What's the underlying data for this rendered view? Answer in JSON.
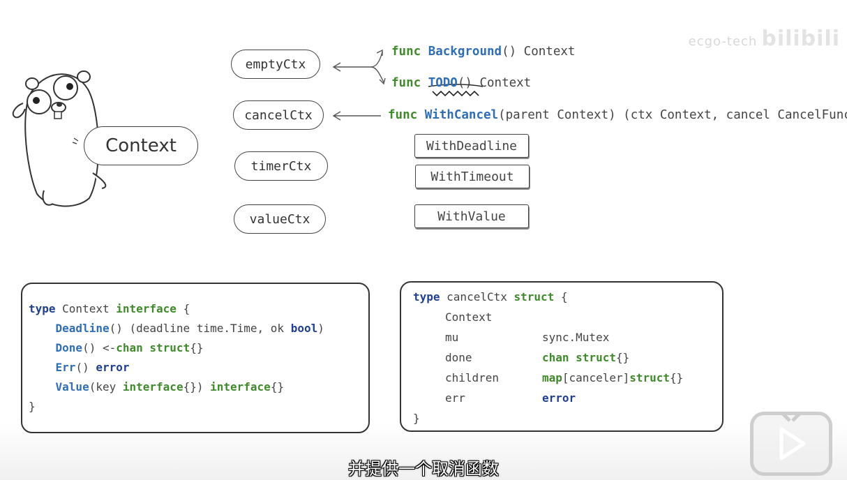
{
  "watermark": {
    "text": "ecgo-tech",
    "logo": "bilibili"
  },
  "ctx_types": [
    "emptyCtx",
    "cancelCtx",
    "timerCtx",
    "valueCtx"
  ],
  "mascot": {
    "label": "Context"
  },
  "signatures": {
    "background": {
      "kw": "func",
      "name": "Background",
      "rest": "() Context"
    },
    "todo": {
      "kw": "func",
      "name": "TODO",
      "rest": "() Context"
    },
    "withcancel": {
      "kw": "func",
      "name": "WithCancel",
      "rest": "(parent Context) (ctx Context, cancel CancelFunc)"
    }
  },
  "with_boxes": [
    "WithDeadline",
    "WithTimeout",
    "WithValue"
  ],
  "code_interface": {
    "l1": {
      "a": "type",
      "b": " Context ",
      "c": "interface",
      "d": " {"
    },
    "l2": {
      "a": "Deadline",
      "b": "() (deadline time.Time, ok ",
      "c": "bool",
      "d": ")"
    },
    "l3": {
      "a": "Done",
      "b": "() <-",
      "c": "chan struct",
      "d": "{}"
    },
    "l4": {
      "a": "Err",
      "b": "() ",
      "c": "error"
    },
    "l5": {
      "a": "Value",
      "b": "(key ",
      "c": "interface",
      "d": "{}) ",
      "e": "interface",
      "f": "{}"
    },
    "l6": "}"
  },
  "code_struct": {
    "l1": {
      "a": "type",
      "b": " cancelCtx ",
      "c": "struct",
      "d": " {"
    },
    "fields": [
      {
        "name": "Context",
        "type_plain": "",
        "type_kw": "",
        "type_rest": ""
      },
      {
        "name": "mu",
        "type_plain": "sync.Mutex",
        "type_kw": "",
        "type_rest": ""
      },
      {
        "name": "done",
        "type_plain": "",
        "type_kw": "chan struct",
        "type_rest": "{}"
      },
      {
        "name": "children",
        "type_plain": "",
        "type_kw": "map",
        "type_rest": "[canceler]",
        "type_kw2": "struct",
        "type_rest2": "{}"
      },
      {
        "name": "err",
        "type_plain": "",
        "type_kw": "error",
        "type_rest": ""
      }
    ],
    "close": "}"
  },
  "subtitle": "并提供一个取消函数",
  "colors": {
    "keyword_green": "#3f8a2a",
    "func_blue": "#2f6eb5",
    "type_navy": "#1f3f8f"
  }
}
